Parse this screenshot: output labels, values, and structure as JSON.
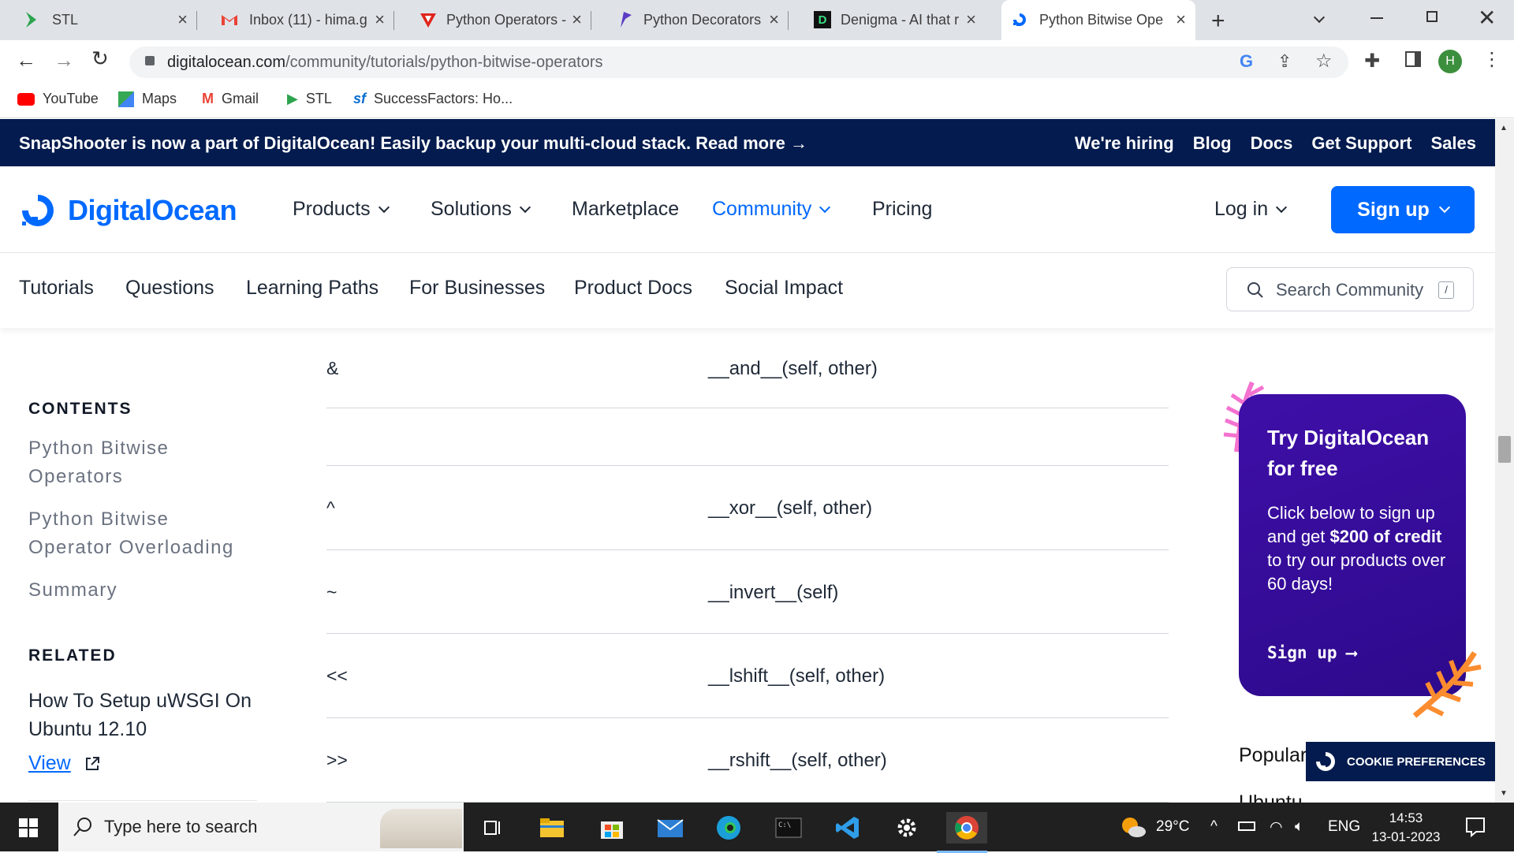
{
  "browser": {
    "tabs": [
      {
        "title": "STL",
        "icon": "stl-icon"
      },
      {
        "title": "Inbox (11) - hima.g",
        "icon": "gmail-icon"
      },
      {
        "title": "Python Operators -",
        "icon": "tutorialspoint-icon"
      },
      {
        "title": "Python Decorators",
        "icon": "programiz-icon"
      },
      {
        "title": "Denigma - AI that r",
        "icon": "denigma-icon"
      },
      {
        "title": "Python Bitwise Ope",
        "icon": "digitalocean-icon",
        "active": true
      }
    ],
    "url_host": "digitalocean.com",
    "url_path": "/community/tutorials/python-bitwise-operators",
    "profile_initial": "H",
    "bookmarks": [
      "YouTube",
      "Maps",
      "Gmail",
      "STL",
      "SuccessFactors: Ho..."
    ]
  },
  "promo_bar": {
    "message": "SnapShooter is now a part of DigitalOcean! Easily backup your multi-cloud stack. Read more →",
    "links": [
      "We're hiring",
      "Blog",
      "Docs",
      "Get Support",
      "Sales"
    ]
  },
  "nav": {
    "brand": "DigitalOcean",
    "items": [
      "Products",
      "Solutions",
      "Marketplace",
      "Community",
      "Pricing"
    ],
    "login": "Log in",
    "signup": "Sign up"
  },
  "subnav": {
    "items": [
      "Tutorials",
      "Questions",
      "Learning Paths",
      "For Businesses",
      "Product Docs",
      "Social Impact"
    ],
    "search_placeholder": "Search Community",
    "search_key": "/"
  },
  "sidebar": {
    "contents_heading": "CONTENTS",
    "contents": [
      "Python Bitwise Operators",
      "Python Bitwise Operator Overloading",
      "Summary"
    ],
    "related_heading": "RELATED",
    "related_title": "How To Setup uWSGI On Ubuntu 12.10",
    "view_label": "View"
  },
  "table": {
    "rows": [
      {
        "operator": "&",
        "method": "__and__(self, other)"
      },
      {
        "operator": "",
        "method": ""
      },
      {
        "operator": "^",
        "method": "__xor__(self, other)"
      },
      {
        "operator": "~",
        "method": "__invert__(self)"
      },
      {
        "operator": "<<",
        "method": "__lshift__(self, other)"
      },
      {
        "operator": ">>",
        "method": "__rshift__(self, other)"
      }
    ]
  },
  "card": {
    "title": "Try DigitalOcean for free",
    "body_pre": "Click below to sign up and get ",
    "body_bold": "$200 of credit",
    "body_post": " to try our products over 60 days!",
    "cta": "Sign up"
  },
  "popular_label": "Popular",
  "popular_partial": "Ubuntu",
  "cookie_label": "COOKIE PREFERENCES",
  "taskbar": {
    "search_placeholder": "Type here to search",
    "temperature": "29°C",
    "language": "ENG",
    "time": "14:53",
    "date": "13-01-2023"
  },
  "colors": {
    "brand": "#0069ff",
    "promo_bg": "#031b4e",
    "card_bg": "#3a0ca3"
  }
}
